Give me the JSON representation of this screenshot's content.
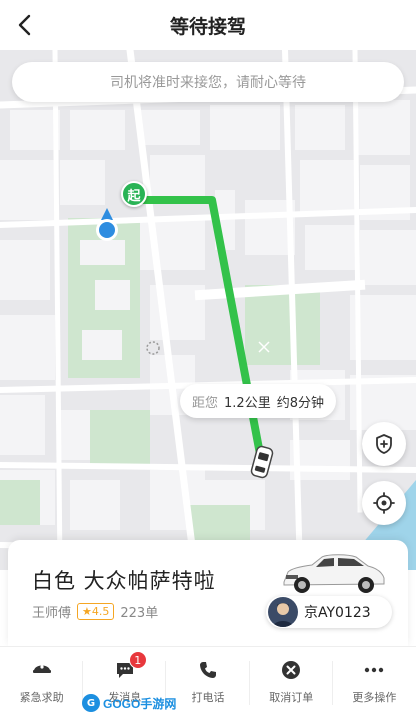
{
  "header": {
    "title": "等待接驾"
  },
  "map": {
    "notice": "司机将准时来接您，请耐心等待",
    "start_label": "起",
    "distance_label": "距您",
    "distance_value": "1.2公里",
    "eta": "约8分钟"
  },
  "driver": {
    "car_description": "白色 大众帕萨特啦",
    "name": "王师傅",
    "rating": "★4.5",
    "orders": "223单",
    "plate": "京AY0123"
  },
  "actions": [
    {
      "label": "紧急求助",
      "icon": "police-icon"
    },
    {
      "label": "发消息",
      "icon": "message-icon",
      "badge": "1"
    },
    {
      "label": "打电话",
      "icon": "phone-icon"
    },
    {
      "label": "取消订单",
      "icon": "cancel-icon"
    },
    {
      "label": "更多操作",
      "icon": "more-icon"
    }
  ],
  "watermark": {
    "logo": "G",
    "text": "GOGO手游网"
  },
  "colors": {
    "route": "#33c24a",
    "accent": "#29b355",
    "badge": "#e8383d",
    "rating": "#f5a623"
  }
}
